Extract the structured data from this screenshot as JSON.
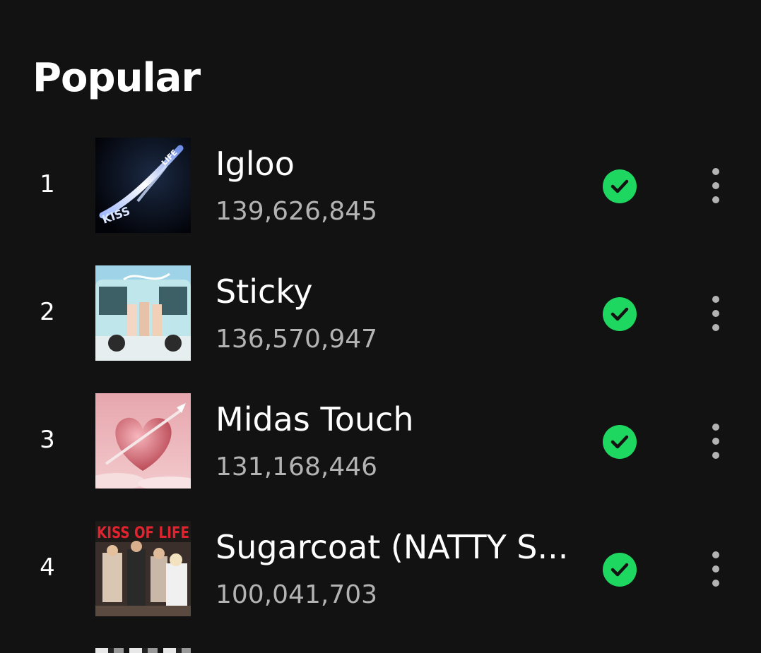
{
  "section": {
    "title": "Popular"
  },
  "tracks": [
    {
      "rank": "1",
      "title": "Igloo",
      "plays": "139,626,845",
      "cover_icon": "album-cover-igloo",
      "downloaded_icon": "downloaded-check-icon",
      "more_icon": "more-options-icon"
    },
    {
      "rank": "2",
      "title": "Sticky",
      "plays": "136,570,947",
      "cover_icon": "album-cover-sticky",
      "downloaded_icon": "downloaded-check-icon",
      "more_icon": "more-options-icon"
    },
    {
      "rank": "3",
      "title": "Midas Touch",
      "plays": "131,168,446",
      "cover_icon": "album-cover-midas-touch",
      "downloaded_icon": "downloaded-check-icon",
      "more_icon": "more-options-icon"
    },
    {
      "rank": "4",
      "title": "Sugarcoat (NATTY S...",
      "plays": "100,041,703",
      "cover_icon": "album-cover-sugarcoat",
      "downloaded_icon": "downloaded-check-icon",
      "more_icon": "more-options-icon"
    }
  ],
  "cover_text": {
    "cover1_logo": "KISS LIFE",
    "cover4_logo": "KISS OF LIFE"
  },
  "colors": {
    "background": "#121212",
    "accent_green": "#1ed760",
    "secondary_text": "#b3b3b3"
  }
}
